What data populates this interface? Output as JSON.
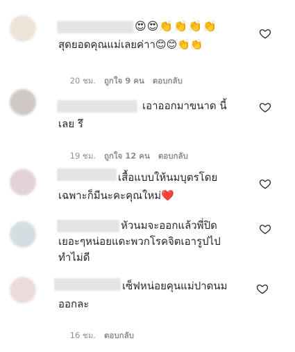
{
  "comments": [
    {
      "line1_emoji": "😍😍👏👏👏👏",
      "line2": "สุดยอดคุณแม่เลยค่าา😊😊👏👏",
      "time": "20 ชม.",
      "likes": "ถูกใจ 9 คน",
      "reply": "ตอบกลับ",
      "avatar_color": "#ede3d8"
    },
    {
      "line1": "เอาออกมาขนาด นี้",
      "line2": "เลย รึ",
      "time": "19 ชม.",
      "likes": "ถูกใจ 12 คน",
      "reply": "ตอบกลับ",
      "avatar_color": "#cfc8c6"
    },
    {
      "line1": "เสื้อแบบให้นมบุตรโดย",
      "line2": "เฉพาะก็มีนะคะคุณใหม่❤️",
      "avatar_color": "#e3d2d7"
    },
    {
      "line1": "หัวนมจะออกแล้วพี่ปิด",
      "line2": "เยอะๆหน่อยแดะพวกโรคจิตเอารูปไป",
      "line3": "ทำไม่ดี",
      "avatar_color": "#d4dde2"
    },
    {
      "line1": "เซ็ฟหน่อยคุนแม่ปาดนม",
      "line2": "ออกละ",
      "time": "16 ชม.",
      "reply": "ตอบกลับ",
      "avatar_color": "#ecdadc"
    }
  ]
}
